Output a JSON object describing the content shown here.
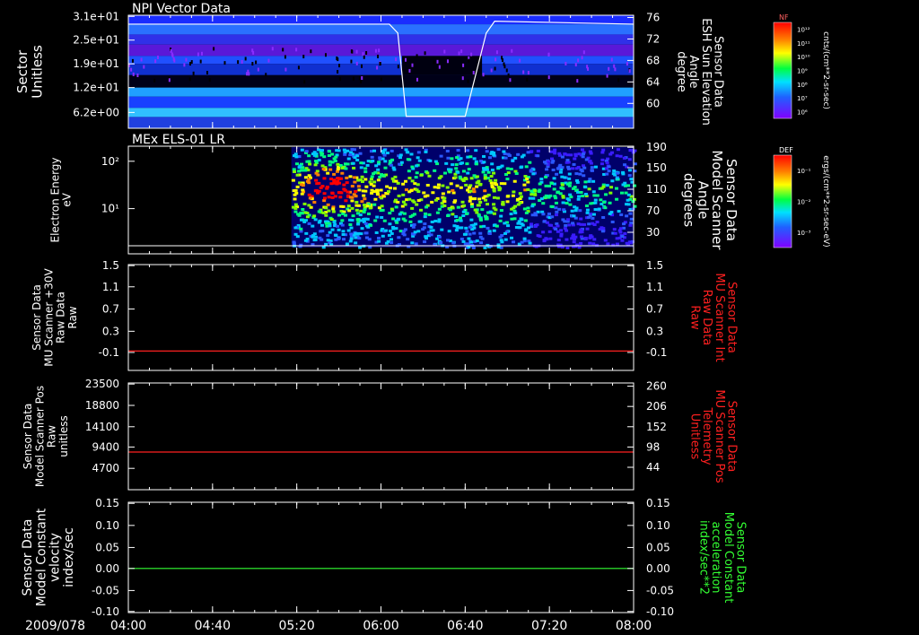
{
  "colors": {
    "background": "#000000",
    "axis": "#ffffff",
    "red_trace": "#ff2020",
    "green_trace": "#33ff33"
  },
  "chart_data": [
    {
      "type": "heatmap",
      "title": "NPI Vector Data",
      "ylabel": [
        "Sector",
        "Unitless"
      ],
      "y_ticks": [
        "3.1e+01",
        "2.5e+01",
        "1.9e+01",
        "1.2e+01",
        "6.2e+00"
      ],
      "right_ylabel": [
        "Sensor Data",
        "ESH Sun Elevation",
        "Angle",
        "degree"
      ],
      "right_ticks": [
        76,
        72,
        68,
        64,
        60
      ],
      "right_ylim": [
        57,
        76
      ],
      "overlay_line": {
        "x": [
          "04:00",
          "06:04",
          "06:08",
          "06:12",
          "06:40",
          "06:50",
          "06:54",
          "08:00"
        ],
        "y": [
          74.5,
          74.5,
          73,
          59,
          59,
          73,
          75,
          74.5
        ]
      },
      "colorbar": {
        "label": "NF",
        "units": "cnts/(cm**2-sr-sec)",
        "ticks": [
          "10¹²",
          "10¹¹",
          "10¹⁰",
          "10⁹",
          "10⁸",
          "10⁷",
          "10⁶"
        ]
      }
    },
    {
      "type": "heatmap",
      "title": "MEx ELS-01 LR",
      "ylabel": [
        "Electron Energy",
        "eV"
      ],
      "y_ticks": [
        "10²",
        "10¹"
      ],
      "right_ylabel": [
        "Sensor Data",
        "Model Scanner",
        "Angle",
        "degrees"
      ],
      "right_ticks": [
        190,
        150,
        110,
        70,
        30
      ],
      "colorbar": {
        "label": "DEF",
        "units": "ergs/(cm**2-sr-sec-eV)",
        "ticks": [
          "10⁻¹",
          "10⁻²",
          "10⁻³"
        ]
      }
    },
    {
      "type": "line",
      "ylabel": [
        "Sensor Data",
        "MU Scanner +30V",
        "Raw Data",
        "Raw"
      ],
      "y_ticks": [
        "1.5",
        "1.1",
        "0.7",
        "0.3",
        "-0.1"
      ],
      "ylim": [
        -0.3,
        1.5
      ],
      "right_ylabel": [
        "Sensor Data",
        "MU Scanner Int",
        "Raw Data",
        "Raw"
      ],
      "right_ticks": [
        "1.5",
        "1.1",
        "0.7",
        "0.3",
        "-0.1"
      ],
      "series": [
        {
          "x": [
            "04:00",
            "08:00"
          ],
          "y": [
            0.03,
            0.03
          ]
        }
      ]
    },
    {
      "type": "line",
      "ylabel": [
        "Sensor Data",
        "Model Scanner Pos",
        "Raw",
        "unitless"
      ],
      "y_ticks": [
        23500,
        18800,
        14100,
        9400,
        4700
      ],
      "ylim": [
        0,
        23500
      ],
      "right_ylabel": [
        "Sensor Data",
        "MU Scanner Pos",
        "Telemetry",
        "Unitless"
      ],
      "right_ticks": [
        260,
        206,
        152,
        98,
        44
      ],
      "right_ylim": [
        0,
        260
      ],
      "series": [
        {
          "x": [
            "04:00",
            "08:00"
          ],
          "y": [
            8300,
            8300
          ]
        }
      ]
    },
    {
      "type": "line",
      "ylabel": [
        "Sensor Data",
        "Model Constant",
        "velocity",
        "index/sec"
      ],
      "y_ticks": [
        "0.15",
        "0.10",
        "0.05",
        "0.00",
        "-0.05",
        "-0.10"
      ],
      "ylim": [
        -0.1,
        0.15
      ],
      "right_ylabel": [
        "Sensor Data",
        "Model Constant",
        "acceleration",
        "index/sec**2"
      ],
      "right_ticks": [
        "0.15",
        "0.10",
        "0.05",
        "0.00",
        "-0.05",
        "-0.10"
      ],
      "series": [
        {
          "x": [
            "04:00",
            "08:00"
          ],
          "y": [
            0.0,
            0.0
          ]
        }
      ]
    }
  ],
  "x_axis": {
    "date": "2009/078",
    "ticks": [
      "04:00",
      "04:40",
      "05:20",
      "06:00",
      "06:40",
      "07:20",
      "08:00"
    ]
  }
}
